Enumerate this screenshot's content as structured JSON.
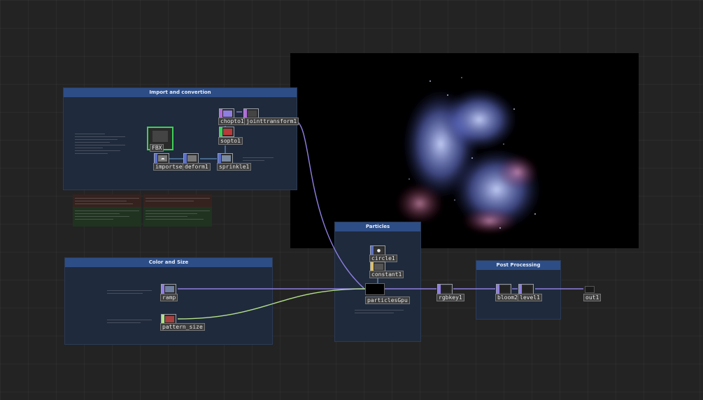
{
  "boxes": {
    "import": "Import and convertion",
    "color": "Color and Size",
    "particles": "Particles",
    "post": "Post Processing"
  },
  "nodes": {
    "fbx": "FBX",
    "importse": "importse",
    "deform1": "deform1",
    "sprinkle1": "sprinkle1",
    "sopto1": "sopto1",
    "chopto1": "chopto1",
    "jointtransform1": "jointtransform1",
    "ramp": "ramp",
    "pattern_size": "pattern_size",
    "circle1": "circle1",
    "constant1": "constant1",
    "particlesGpu": "particlesGpu",
    "rgbkey1": "rgbkey1",
    "bloom2": "bloom2",
    "level1": "level1",
    "out1": "out1"
  },
  "colors": {
    "wire_purple": "#8f7fe0",
    "wire_green": "#b4e08a",
    "box_title_bg": "#2d4d86",
    "box_bg": "#1f2a3c"
  }
}
